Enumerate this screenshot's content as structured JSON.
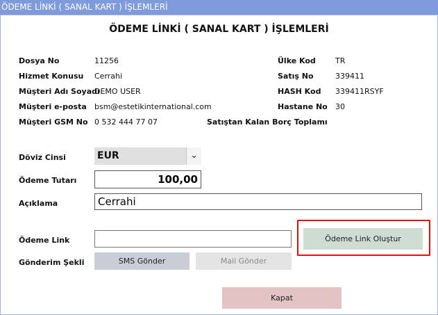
{
  "window": {
    "title": "ÖDEME LİNKİ ( SANAL KART ) İŞLEMLERİ"
  },
  "page": {
    "heading": "ÖDEME LİNKİ ( SANAL KART ) İŞLEMLERİ"
  },
  "info_left": [
    {
      "label": "Dosya No",
      "value": "11256"
    },
    {
      "label": "Hizmet Konusu",
      "value": "Cerrahi"
    },
    {
      "label": "Müşteri Adı Soyadı",
      "value": "DEMO USER"
    },
    {
      "label": "Müşteri e-posta",
      "value": "bsm@estetikinternational.com"
    },
    {
      "label": "Müşteri GSM No",
      "value": "0 532 444 77 07"
    }
  ],
  "info_right": [
    {
      "label": "Ülke Kod",
      "value": "TR"
    },
    {
      "label": "Satış No",
      "value": "339411"
    },
    {
      "label": "HASH Kod",
      "value": "339411RSYF"
    },
    {
      "label": "Hastane No",
      "value": "30"
    },
    {
      "label": "Satıştan Kalan Borç Toplamı",
      "value": ""
    }
  ],
  "form": {
    "currency_label": "Döviz Cinsi",
    "currency_value": "EUR",
    "currency_arrow": "⌄",
    "amount_label": "Ödeme Tutarı",
    "amount_value": "100,00",
    "description_label": "Açıklama",
    "description_value": "Cerrahi",
    "link_label": "Ödeme Link",
    "link_value": "",
    "send_label": "Gönderim Şekli"
  },
  "buttons": {
    "create_link": "Ödeme Link Oluştur",
    "sms": "SMS Gönder",
    "mail": "Mail Gönder",
    "close": "Kapat"
  },
  "colors": {
    "titlebar": "#7f9bdc",
    "highlight": "#e01010",
    "create_button": "#cfdcd1",
    "close_button": "#e3c3c3"
  }
}
